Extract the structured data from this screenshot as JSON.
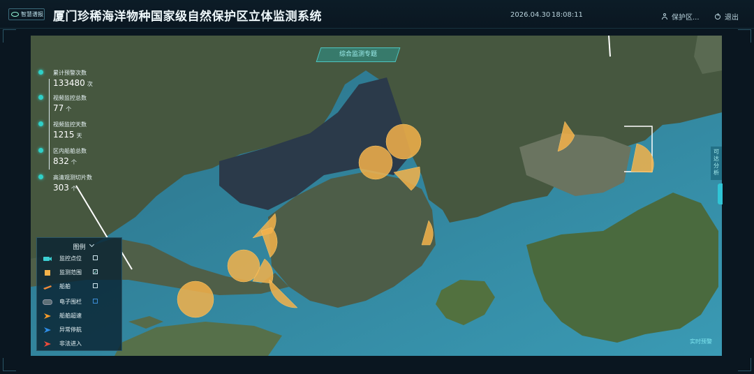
{
  "header": {
    "logo_text": "智慧谱报",
    "title": "厦门珍稀海洋物种国家级自然保护区立体监测系统",
    "date": "2026.04.30",
    "time": "18:08:11",
    "user_label": "保护区...",
    "exit_label": "退出"
  },
  "map": {
    "tab_label": "综合监测专题",
    "side_panel_label": "可达分析",
    "realtime_label": "实时预警"
  },
  "stats": [
    {
      "label": "累计预警次数",
      "value": "133480",
      "unit": "次"
    },
    {
      "label": "视频监控总数",
      "value": "77",
      "unit": "个"
    },
    {
      "label": "视频监控天数",
      "value": "1215",
      "unit": "天"
    },
    {
      "label": "区内船舶总数",
      "value": "832",
      "unit": "个"
    },
    {
      "label": "高清观测切片数",
      "value": "303",
      "unit": "个"
    }
  ],
  "legend": {
    "title": "图例",
    "items": [
      {
        "label": "监控点位",
        "icon": "camera-icon",
        "checked": false
      },
      {
        "label": "监测范围",
        "icon": "range-icon",
        "checked": true
      },
      {
        "label": "船舶",
        "icon": "ship-icon",
        "checked": false
      },
      {
        "label": "电子围栏",
        "icon": "fence-icon",
        "checked": false
      },
      {
        "label": "船舶超速",
        "icon": "arrow-orange-icon",
        "checked": null
      },
      {
        "label": "异常停航",
        "icon": "arrow-blue-icon",
        "checked": null
      },
      {
        "label": "非法进入",
        "icon": "arrow-red-icon",
        "checked": null
      }
    ]
  },
  "colors": {
    "accent": "#2fd0c8",
    "range_fill": "#f4b24a",
    "sea": "#2d7a92",
    "land": "#4a5d45"
  }
}
